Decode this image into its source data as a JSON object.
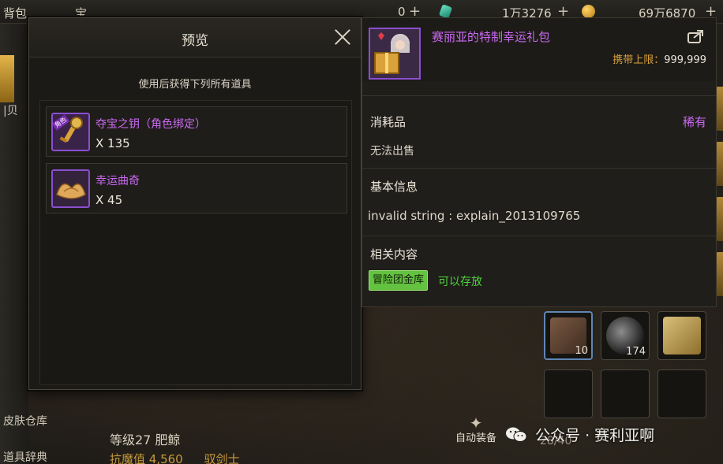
{
  "top_bar": {
    "bag_label": "背包",
    "tab2_label": "宝",
    "currency_partial": "0",
    "currency_partial_2": "1万3276",
    "zero_value": "0",
    "coupon_value": "1万3276",
    "gold_value": "69万6870",
    "plus": "+"
  },
  "preview": {
    "title": "预览",
    "subtitle": "使用后获得下列所有道具",
    "rewards": [
      {
        "name": "夺宝之钥（角色绑定）",
        "quantity": "X 135",
        "tag": "角色",
        "icon": "golden-key-icon"
      },
      {
        "name": "幸运曲奇",
        "quantity": "X 45",
        "icon": "fortune-cookie-icon"
      }
    ]
  },
  "item": {
    "name": "赛丽亚的特制幸运礼包",
    "carry_limit_label": "携带上限：",
    "carry_limit_value": "999,999",
    "type": "消耗品",
    "rarity": "稀有",
    "sell_status": "无法出售",
    "basic_info_label": "基本信息",
    "explain": "invalid string : explain_2013109765",
    "related_label": "相关内容",
    "storage_badge": "冒险团金库",
    "storage_note": "可以存放",
    "icon": "seria-gift-icon",
    "share_icon": "share-icon"
  },
  "sidebar": {
    "skin_storage": "皮肤仓库",
    "item_dictionary": "道具辞典",
    "partial_label": "|贝"
  },
  "character": {
    "level_text": "等级27 肥鲸",
    "resist_text": "抗魔值 4,560",
    "class_text": "驭剑士"
  },
  "inventory": {
    "slot_counts": [
      "10",
      "174"
    ],
    "capacity": "28/40",
    "auto_equip": "自动装备"
  },
  "watermark": "公众号 · 赛利亚啊",
  "colors": {
    "rare_purple": "#c96af0",
    "accent_gold": "#d9a23a",
    "storage_green": "#63c23f"
  }
}
